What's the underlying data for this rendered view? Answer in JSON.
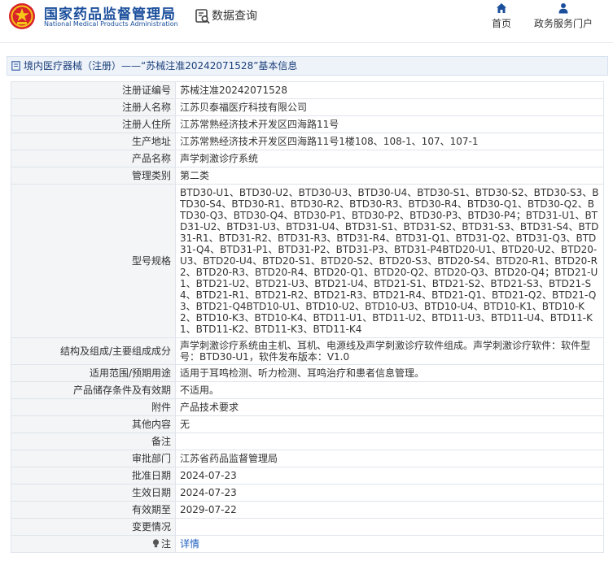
{
  "header": {
    "org_cn": "国家药品监督管理局",
    "org_en": "National Medical Products Administration",
    "query_label": "数据查询",
    "nav_home": "首页",
    "nav_service": "政务服务门户"
  },
  "breadcrumb": {
    "text": "境内医疗器械（注册）——“苏械注准20242071528”基本信息"
  },
  "details": {
    "rows": [
      {
        "label": "注册证编号",
        "value": "苏械注准20242071528"
      },
      {
        "label": "注册人名称",
        "value": "江苏贝泰福医疗科技有限公司"
      },
      {
        "label": "注册人住所",
        "value": "江苏常熟经济技术开发区四海路11号"
      },
      {
        "label": "生产地址",
        "value": "江苏常熟经济技术开发区四海路11号1楼108、108-1、107、107-1"
      },
      {
        "label": "产品名称",
        "value": "声学刺激诊疗系统"
      },
      {
        "label": "管理类别",
        "value": "第二类"
      },
      {
        "label": "型号规格",
        "value": "BTD30-U1、BTD30-U2、BTD30-U3、BTD30-U4、BTD30-S1、BTD30-S2、BTD30-S3、BTD30-S4、BTD30-R1、BTD30-R2、BTD30-R3、BTD30-R4、BTD30-Q1、BTD30-Q2、BTD30-Q3、BTD30-Q4、BTD30-P1、BTD30-P2、BTD30-P3、BTD30-P4；BTD31-U1、BTD31-U2、BTD31-U3、BTD31-U4、BTD31-S1、BTD31-S2、BTD31-S3、BTD31-S4、BTD31-R1、BTD31-R2、BTD31-R3、BTD31-R4、BTD31-Q1、BTD31-Q2、BTD31-Q3、BTD31-Q4、BTD31-P1、BTD31-P2、BTD31-P3、BTD31-P4BTD20-U1、BTD20-U2、BTD20-U3、BTD20-U4、BTD20-S1、BTD20-S2、BTD20-S3、BTD20-S4、BTD20-R1、BTD20-R2、BTD20-R3、BTD20-R4、BTD20-Q1、BTD20-Q2、BTD20-Q3、BTD20-Q4；BTD21-U1、BTD21-U2、BTD21-U3、BTD21-U4、BTD21-S1、BTD21-S2、BTD21-S3、BTD21-S4、BTD21-R1、BTD21-R2、BTD21-R3、BTD21-R4、BTD21-Q1、BTD21-Q2、BTD21-Q3、BTD21-Q4BTD10-U1、BTD10-U2、BTD10-U3、BTD10-U4、BTD10-K1、BTD10-K2、BTD10-K3、BTD10-K4、BTD11-U1、BTD11-U2、BTD11-U3、BTD11-U4、BTD11-K1、BTD11-K2、BTD11-K3、BTD11-K4"
      },
      {
        "label": "结构及组成/主要组成成分",
        "value": "声学刺激诊疗系统由主机、耳机、电源线及声学刺激诊疗软件组成。声学刺激诊疗软件：软件型号：BTD30-U1，软件发布版本：V1.0"
      },
      {
        "label": "适用范围/预期用途",
        "value": "适用于耳鸣检测、听力检测、耳鸣治疗和患者信息管理。"
      },
      {
        "label": "产品储存条件及有效期",
        "value": "不适用。"
      },
      {
        "label": "附件",
        "value": "产品技术要求"
      },
      {
        "label": "其他内容",
        "value": "无"
      },
      {
        "label": "备注",
        "value": ""
      },
      {
        "label": "审批部门",
        "value": "江苏省药品监督管理局"
      },
      {
        "label": "批准日期",
        "value": "2024-07-23"
      },
      {
        "label": "生效日期",
        "value": "2024-07-23"
      },
      {
        "label": "有效期至",
        "value": "2029-07-22"
      },
      {
        "label": "变更情况",
        "value": ""
      },
      {
        "label": "注",
        "value": "详情"
      }
    ]
  },
  "colors": {
    "brand_blue": "#1b4f9c",
    "link_blue": "#1f5fbf",
    "label_bg": "#f3f5f7",
    "border": "#dfe4ea",
    "crumb_bg": "#eef3fa"
  },
  "icons": {
    "logo": "national-emblem-icon",
    "query": "data-query-icon",
    "home": "home-icon",
    "service": "user-icon",
    "crumb": "document-icon",
    "note": "bulb-icon"
  }
}
